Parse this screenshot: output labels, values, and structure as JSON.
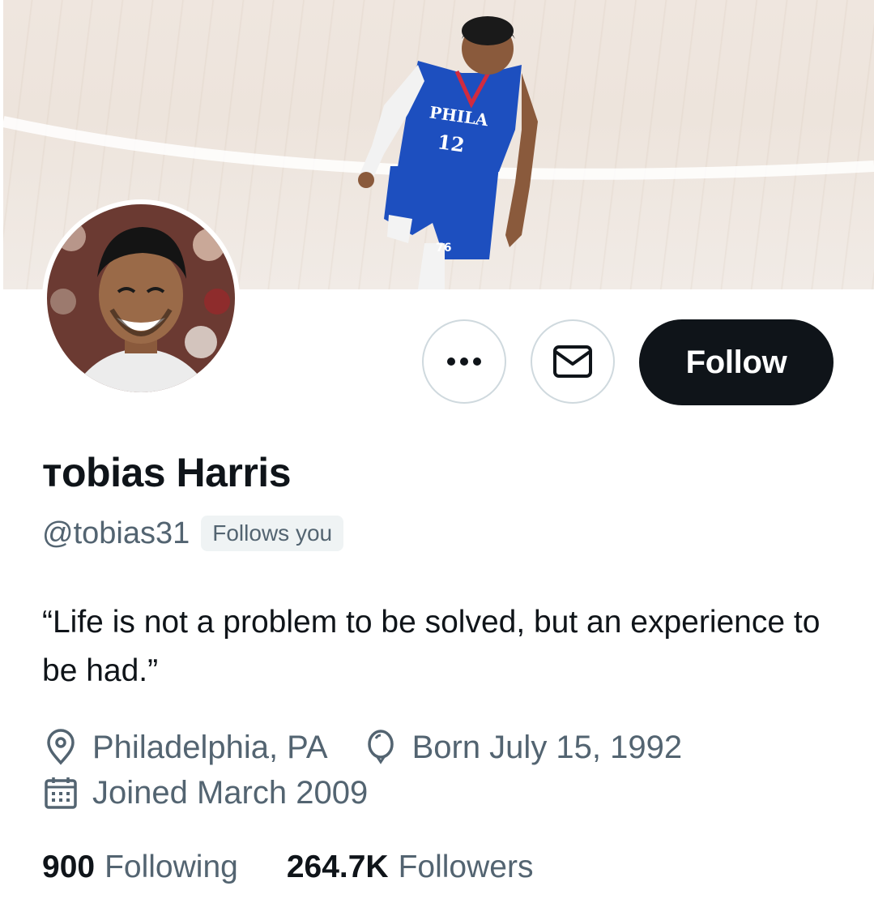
{
  "profile": {
    "display_name": "ᴛobias Harris",
    "handle": "@tobias31",
    "follows_you": "Follows you",
    "bio": "“Life is not a problem to be solved, but an experience to be had.”",
    "location": "Philadelphia, PA",
    "birthday": "Born July 15, 1992",
    "joined": "Joined March 2009"
  },
  "banner": {
    "jersey_text": "PHILA",
    "jersey_number": "12",
    "shorts_logo": "76"
  },
  "actions": {
    "more_icon": "more-horizontal-icon",
    "message_icon": "envelope-icon",
    "follow_label": "Follow"
  },
  "stats": {
    "following_count": "900",
    "following_label": "Following",
    "followers_count": "264.7K",
    "followers_label": "Followers"
  },
  "colors": {
    "text_primary": "#0f1419",
    "text_secondary": "#536471",
    "follow_bg": "#0f1419",
    "border": "#cfd9de",
    "jersey_blue": "#1d4fbf"
  }
}
